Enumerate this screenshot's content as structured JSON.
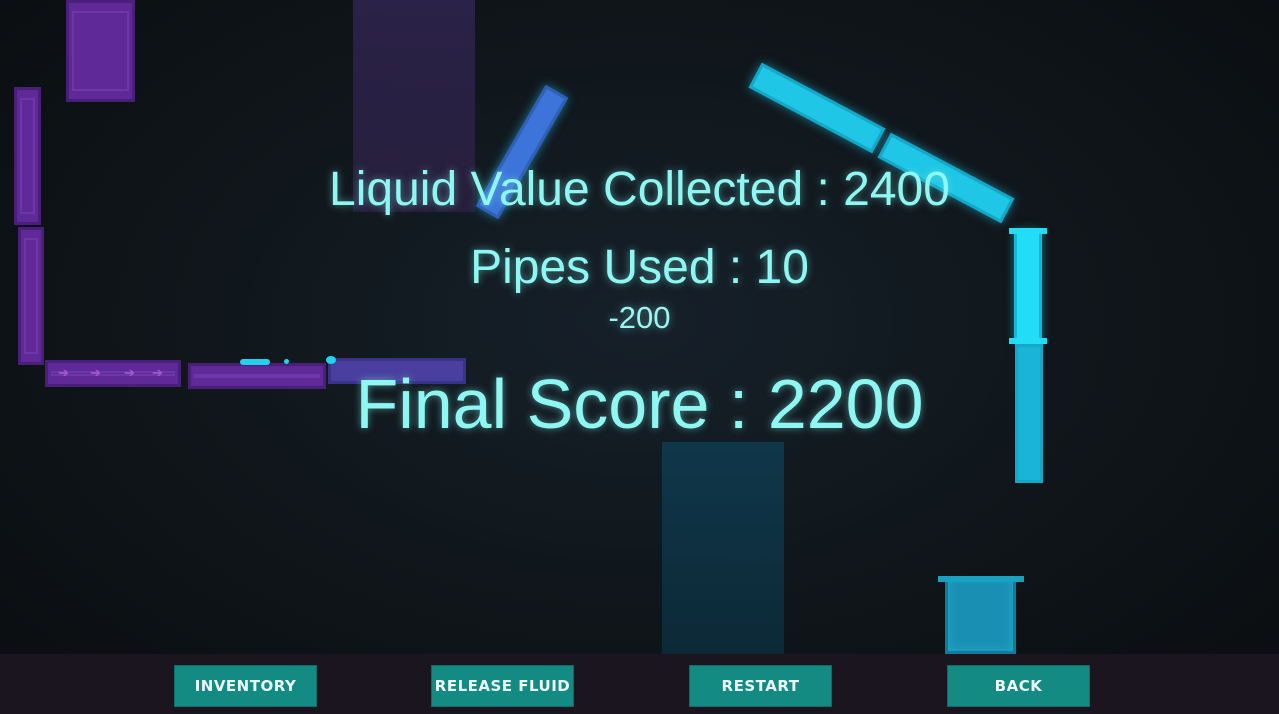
{
  "hud": {
    "liquid_value": "Liquid Value Collected : 2400",
    "pipes_used": "Pipes Used : 10",
    "penalty": "-200",
    "final_score": "Final Score : 2200"
  },
  "toolbar": {
    "inventory_label": "INVENTORY",
    "release_fluid_label": "RELEASE FLUID",
    "restart_label": "RESTART",
    "back_label": "BACK"
  },
  "colors": {
    "hud_text": "#8ff7f2",
    "button_bg": "#138a82",
    "toolbar_bg": "#1a151f",
    "pipe_purple": "#5f2a97",
    "pipe_blue": "#3d74d9",
    "pipe_cyan": "#1fc6e6"
  },
  "icons": {
    "conveyor_arrow": "right-arrow-icon"
  }
}
